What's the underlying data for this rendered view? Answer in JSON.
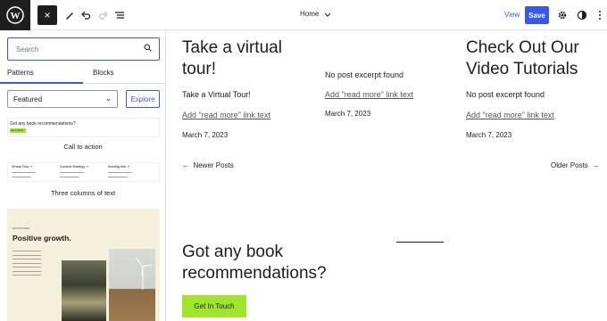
{
  "topbar": {
    "close_icon": "×",
    "breadcrumb": "Home",
    "view_label": "View",
    "save_label": "Save"
  },
  "sidebar": {
    "search_placeholder": "Search",
    "tabs": [
      "Patterns",
      "Blocks"
    ],
    "category": "Featured",
    "explore_label": "Explore",
    "patterns": [
      {
        "caption": "Call to action",
        "preview_text": "Got any book recommendations?",
        "preview_button": "Get In Touch"
      },
      {
        "caption": "Three columns of text",
        "columns": [
          "Virtual Tour ↗",
          "Content Strategy ↗",
          "Hosting Info ↗"
        ]
      },
      {
        "preview_kicker": "ECOSYSTEM",
        "preview_title": "Positive growth."
      }
    ]
  },
  "posts": [
    {
      "title": "Take a virtual tour!",
      "excerpt": "Take a Virtual Tour!",
      "link": "Add \"read more\" link text",
      "date": "March 7, 2023"
    },
    {
      "title": "",
      "excerpt": "No post excerpt found",
      "link": "Add \"read more\" link text",
      "date": "March 7, 2023"
    },
    {
      "title": "Check Out Our Video Tutorials",
      "excerpt": "No post excerpt found",
      "link": "Add \"read more\" link text",
      "date": "March 7, 2023"
    }
  ],
  "nav": {
    "newer": "Newer Posts",
    "older": "Older Posts"
  },
  "cta": {
    "heading": "Got any book recommendations?",
    "button": "Get In Touch"
  },
  "colors": {
    "accent": "#3858e9",
    "cta": "#9ee52b"
  }
}
